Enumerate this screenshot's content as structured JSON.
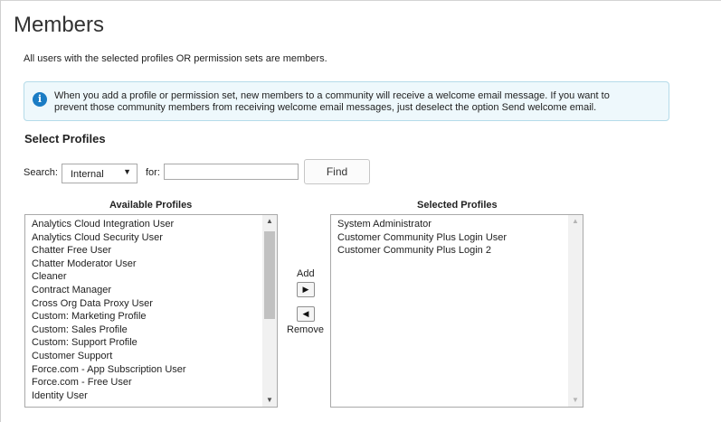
{
  "page": {
    "title": "Members",
    "description": "All users with the selected profiles OR permission sets are members."
  },
  "info": {
    "icon": "info-icon",
    "icon_glyph": "i",
    "line1": "When you add a profile or permission set, new members to a community will receive a welcome email message. If you want to",
    "line2": "prevent those community members from receiving welcome email messages, just deselect the option Send welcome email."
  },
  "section": {
    "title": "Select Profiles"
  },
  "search": {
    "label": "Search:",
    "selected": "Internal",
    "for_label": "for:",
    "query": "",
    "find_label": "Find"
  },
  "available": {
    "header": "Available Profiles",
    "items": [
      "Analytics Cloud Integration User",
      "Analytics Cloud Security User",
      "Chatter Free User",
      "Chatter Moderator User",
      "Cleaner",
      "Contract Manager",
      "Cross Org Data Proxy User",
      "Custom: Marketing Profile",
      "Custom: Sales Profile",
      "Custom: Support Profile",
      "Customer Support",
      "Force.com - App Subscription User",
      "Force.com - Free User",
      "Identity User"
    ]
  },
  "selected": {
    "header": "Selected Profiles",
    "items": [
      "System Administrator",
      "Customer Community Plus Login User",
      "Customer Community Plus Login 2"
    ]
  },
  "transfer": {
    "add_label": "Add",
    "remove_label": "Remove"
  },
  "colors": {
    "info_bg": "#eef8fc",
    "info_border": "#b5dbe9",
    "info_icon": "#1b7cc4"
  }
}
